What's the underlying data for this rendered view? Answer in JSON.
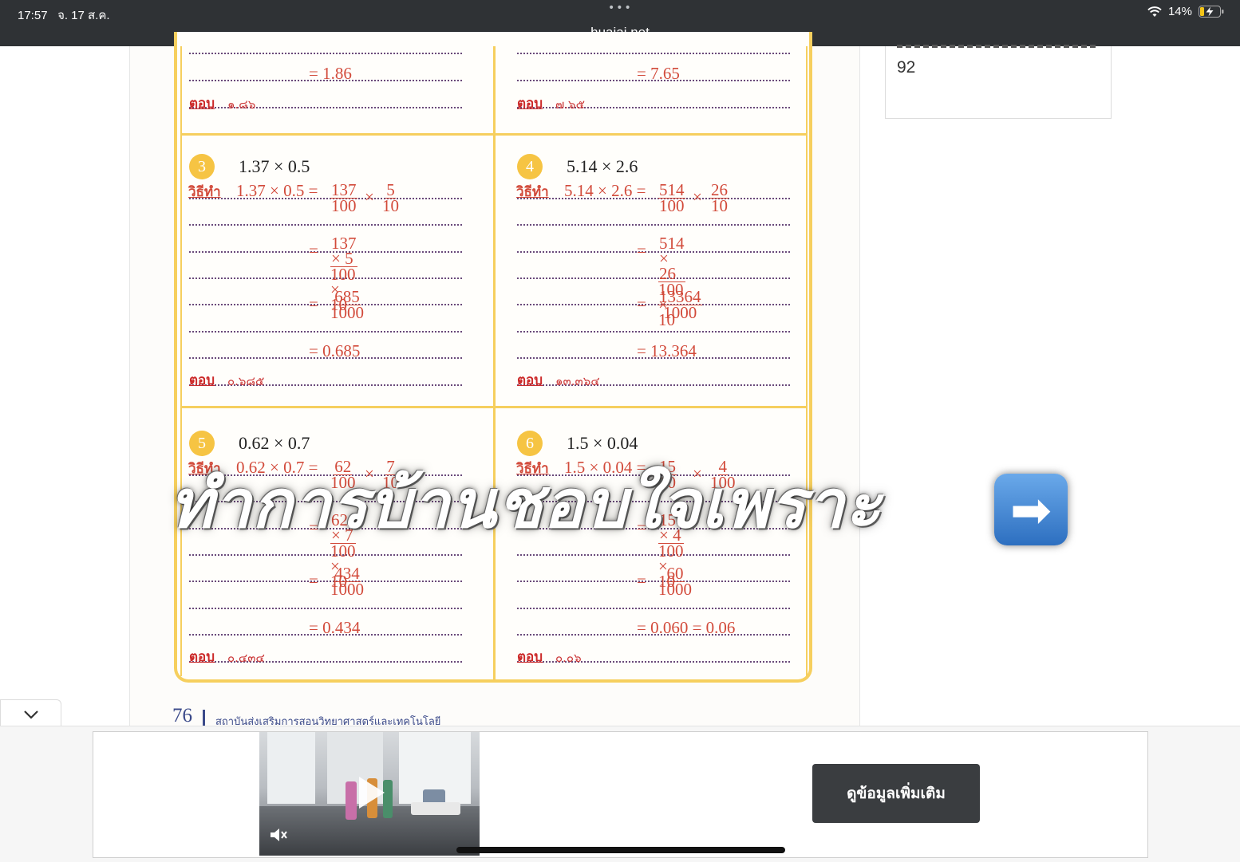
{
  "status": {
    "time": "17:57",
    "date": "จ. 17 ส.ค.",
    "battery": "14%"
  },
  "browser": {
    "dots": "•••",
    "url": "huajai.net"
  },
  "sidebar": {
    "number": "92"
  },
  "sheet": {
    "top": {
      "left": {
        "result": "= 1.86",
        "answer_label": "ตอบ",
        "answer_value": "๑.๘๖"
      },
      "right": {
        "result": "= 7.65",
        "answer_label": "ตอบ",
        "answer_value": "๗.๖๕"
      }
    },
    "problems": [
      {
        "num": "3",
        "expr": "1.37 × 0.5",
        "method_label": "วิธีทำ",
        "step1_lhs": "1.37 × 0.5 =",
        "f1n": "137",
        "f1d": "100",
        "op": "×",
        "f2n": "5",
        "f2d": "10",
        "eq": "=",
        "f3n": "137 × 5",
        "f3d": "100 × 10",
        "f4n": "685",
        "f4d": "1000",
        "result": "= 0.685",
        "answer_label": "ตอบ",
        "answer_value": "๐.๖๘๕"
      },
      {
        "num": "4",
        "expr": "5.14 × 2.6",
        "method_label": "วิธีทำ",
        "step1_lhs": "5.14 × 2.6 =",
        "f1n": "514",
        "f1d": "100",
        "op": "×",
        "f2n": "26",
        "f2d": "10",
        "eq": "=",
        "f3n": "514 × 26",
        "f3d": "100 × 10",
        "f4n": "13364",
        "f4d": "1000",
        "result": "= 13.364",
        "answer_label": "ตอบ",
        "answer_value": "๑๓.๓๖๔"
      },
      {
        "num": "5",
        "expr": "0.62 × 0.7",
        "method_label": "วิธีทำ",
        "step1_lhs": "0.62 × 0.7 =",
        "f1n": "62",
        "f1d": "100",
        "op": "×",
        "f2n": "7",
        "f2d": "10",
        "eq": "=",
        "f3n": "62 × 7",
        "f3d": "100 × 10",
        "f4n": "434",
        "f4d": "1000",
        "result": "= 0.434",
        "answer_label": "ตอบ",
        "answer_value": "๐.๔๓๔"
      },
      {
        "num": "6",
        "expr": "1.5 × 0.04",
        "method_label": "วิธีทำ",
        "step1_lhs": "1.5 × 0.04 =",
        "f1n": "15",
        "f1d": "10",
        "op": "×",
        "f2n": "4",
        "f2d": "100",
        "eq": "=",
        "f3n": "15 × 4",
        "f3d": "100 × 10",
        "f4n": "60",
        "f4d": "1000",
        "result": "= 0.060  =  0.06",
        "answer_label": "ตอบ",
        "answer_value": "๐.๐๖"
      }
    ],
    "page_number": "76",
    "publisher": "สถาบันส่งเสริมการสอนวิทยาศาสตร์และเทคโนโลยี"
  },
  "overlay": {
    "title": "ทำการบ้านชอบใจเพราะ",
    "arrow": "➡"
  },
  "ad": {
    "cta": "ดูข้อมูลเพิ่มเติม"
  }
}
